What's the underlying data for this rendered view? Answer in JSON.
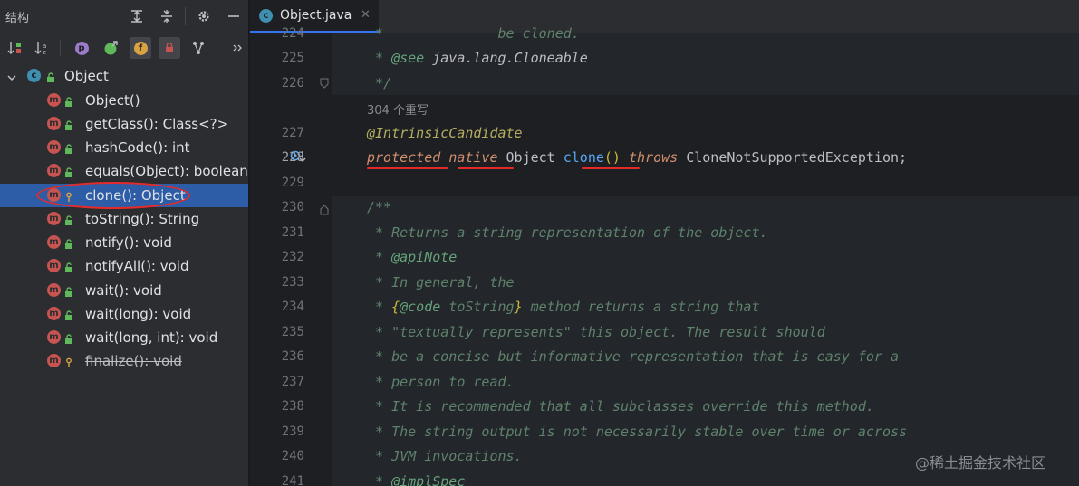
{
  "structure_panel": {
    "title": "结构",
    "toolbar_icon_labels": {
      "p": "p",
      "f": "f"
    },
    "root": {
      "icon_letter": "c",
      "label": "Object"
    },
    "members": [
      {
        "icon_letter": "m",
        "label": "Object()",
        "visibility": "public"
      },
      {
        "icon_letter": "m",
        "label": "getClass(): Class<?>",
        "visibility": "public"
      },
      {
        "icon_letter": "m",
        "label": "hashCode(): int",
        "visibility": "public"
      },
      {
        "icon_letter": "m",
        "label": "equals(Object): boolean",
        "visibility": "public"
      },
      {
        "icon_letter": "m",
        "label": "clone(): Object",
        "visibility": "protected",
        "selected": true
      },
      {
        "icon_letter": "m",
        "label": "toString(): String",
        "visibility": "public"
      },
      {
        "icon_letter": "m",
        "label": "notify(): void",
        "visibility": "public"
      },
      {
        "icon_letter": "m",
        "label": "notifyAll(): void",
        "visibility": "public"
      },
      {
        "icon_letter": "m",
        "label": "wait(): void",
        "visibility": "public"
      },
      {
        "icon_letter": "m",
        "label": "wait(long): void",
        "visibility": "public"
      },
      {
        "icon_letter": "m",
        "label": "wait(long, int): void",
        "visibility": "public"
      },
      {
        "icon_letter": "m",
        "label": "finalize(): void",
        "visibility": "protected",
        "deprecated": true
      }
    ]
  },
  "editor": {
    "tab": {
      "icon_letter": "c",
      "name": "Object.java",
      "close": "✕"
    },
    "inlay_hint": "304 个重写",
    "lines": {
      "224": {
        "num": "224",
        "star": " * ",
        "text": "             be cloned."
      },
      "225": {
        "num": "225",
        "star": " * ",
        "tag": "@see",
        "text": " java.lang.Cloneable"
      },
      "226": {
        "num": "226",
        "text": " */"
      },
      "227": {
        "num": "227",
        "text": "@IntrinsicCandidate"
      },
      "228": {
        "num": "228",
        "kw1": "protected",
        "kw2": "native",
        "type": "Object",
        "method": "clone",
        "paren": "()",
        "kw3": "throws",
        "exc": "CloneNotSupportedException",
        "semi": ";"
      },
      "229": {
        "num": "229"
      },
      "230": {
        "num": "230",
        "text": "/**"
      },
      "231": {
        "num": "231",
        "text": " * Returns a string representation of the object."
      },
      "232": {
        "num": "232",
        "star": " * ",
        "tag": "@apiNote"
      },
      "233": {
        "num": "233",
        "text": " * In general, the"
      },
      "234": {
        "num": "234",
        "star": " * ",
        "brace_open": "{",
        "tag": "@code",
        "code": " toString",
        "brace_close": "}",
        "text": " method returns a string that"
      },
      "235": {
        "num": "235",
        "text": " * \"textually represents\" this object. The result should"
      },
      "236": {
        "num": "236",
        "text": " * be a concise but informative representation that is easy for a"
      },
      "237": {
        "num": "237",
        "text": " * person to read."
      },
      "238": {
        "num": "238",
        "text": " * It is recommended that all subclasses override this method."
      },
      "239": {
        "num": "239",
        "text": " * The string output is not necessarily stable over time or across"
      },
      "240": {
        "num": "240",
        "text": " * JVM invocations."
      },
      "241": {
        "num": "241",
        "star": " * ",
        "tag": "@implSpec"
      }
    }
  },
  "watermark": "@稀土掘金技术社区",
  "colors": {
    "panel_bg": "#2b2d30",
    "editor_bg": "#1e1f22",
    "selection": "#2e5da8",
    "method_icon": "#c75450",
    "class_icon": "#3e8fb0",
    "keyword": "#cf8e6d",
    "annotation": "#b3ae60",
    "comment": "#5f826b",
    "doc_tag": "#67a37c",
    "annotation_mark": "#e52a2a"
  }
}
